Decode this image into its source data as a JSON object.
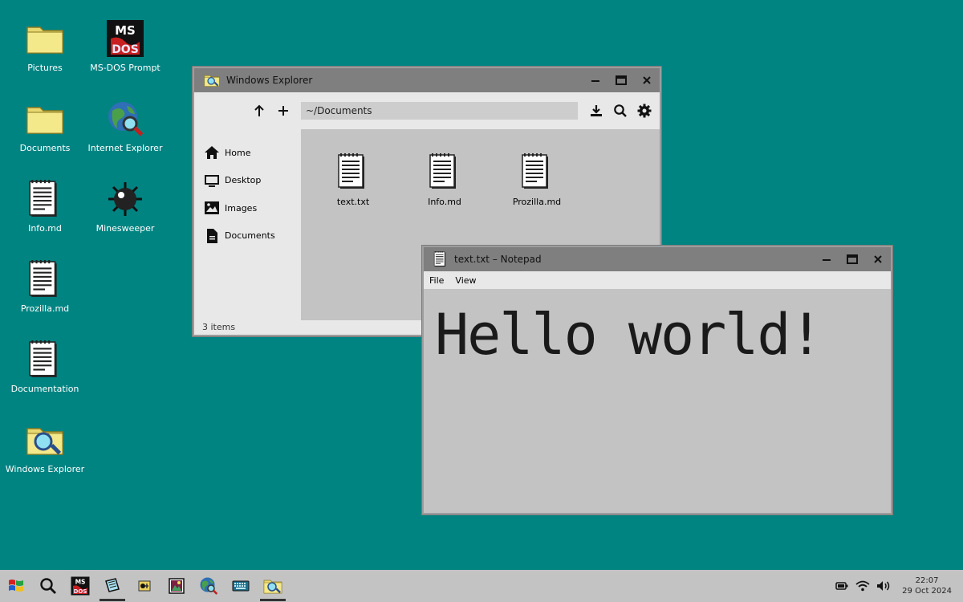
{
  "desktop": {
    "icons": [
      {
        "label": "Pictures",
        "icon": "folder-icon"
      },
      {
        "label": "MS-DOS Prompt",
        "icon": "msdos-icon"
      },
      {
        "label": "Documents",
        "icon": "folder-icon"
      },
      {
        "label": "Internet Explorer",
        "icon": "internet-explorer-icon"
      },
      {
        "label": "Info.md",
        "icon": "text-file-icon"
      },
      {
        "label": "Minesweeper",
        "icon": "mine-icon"
      },
      {
        "label": "Prozilla.md",
        "icon": "text-file-icon"
      },
      {
        "label": "Documentation",
        "icon": "text-file-icon"
      },
      {
        "label": "Windows Explorer",
        "icon": "windows-explorer-icon"
      }
    ]
  },
  "explorer": {
    "title": "Windows Explorer",
    "path": "~/Documents",
    "sidebar": [
      {
        "label": "Home",
        "icon": "home-icon"
      },
      {
        "label": "Desktop",
        "icon": "desktop-icon"
      },
      {
        "label": "Images",
        "icon": "image-icon"
      },
      {
        "label": "Documents",
        "icon": "document-icon"
      }
    ],
    "files": [
      {
        "label": "text.txt",
        "icon": "text-file-icon"
      },
      {
        "label": "Info.md",
        "icon": "text-file-icon"
      },
      {
        "label": "Prozilla.md",
        "icon": "text-file-icon"
      }
    ],
    "status": "3 items"
  },
  "notepad": {
    "title": "text.txt – Notepad",
    "menu": [
      "File",
      "View"
    ],
    "content": "Hello world!"
  },
  "taskbar": {
    "apps": [
      "start-icon",
      "search-icon",
      "msdos-icon",
      "notepad-icon",
      "minesweeper-icon",
      "media-viewer-icon",
      "internet-explorer-icon",
      "keyboard-icon",
      "windows-explorer-icon"
    ],
    "time": "22:07",
    "date": "29 Oct 2024"
  },
  "colors": {
    "desktop": "#008482",
    "window": "#c3c3c3",
    "titlebar": "#7f7f7f"
  }
}
